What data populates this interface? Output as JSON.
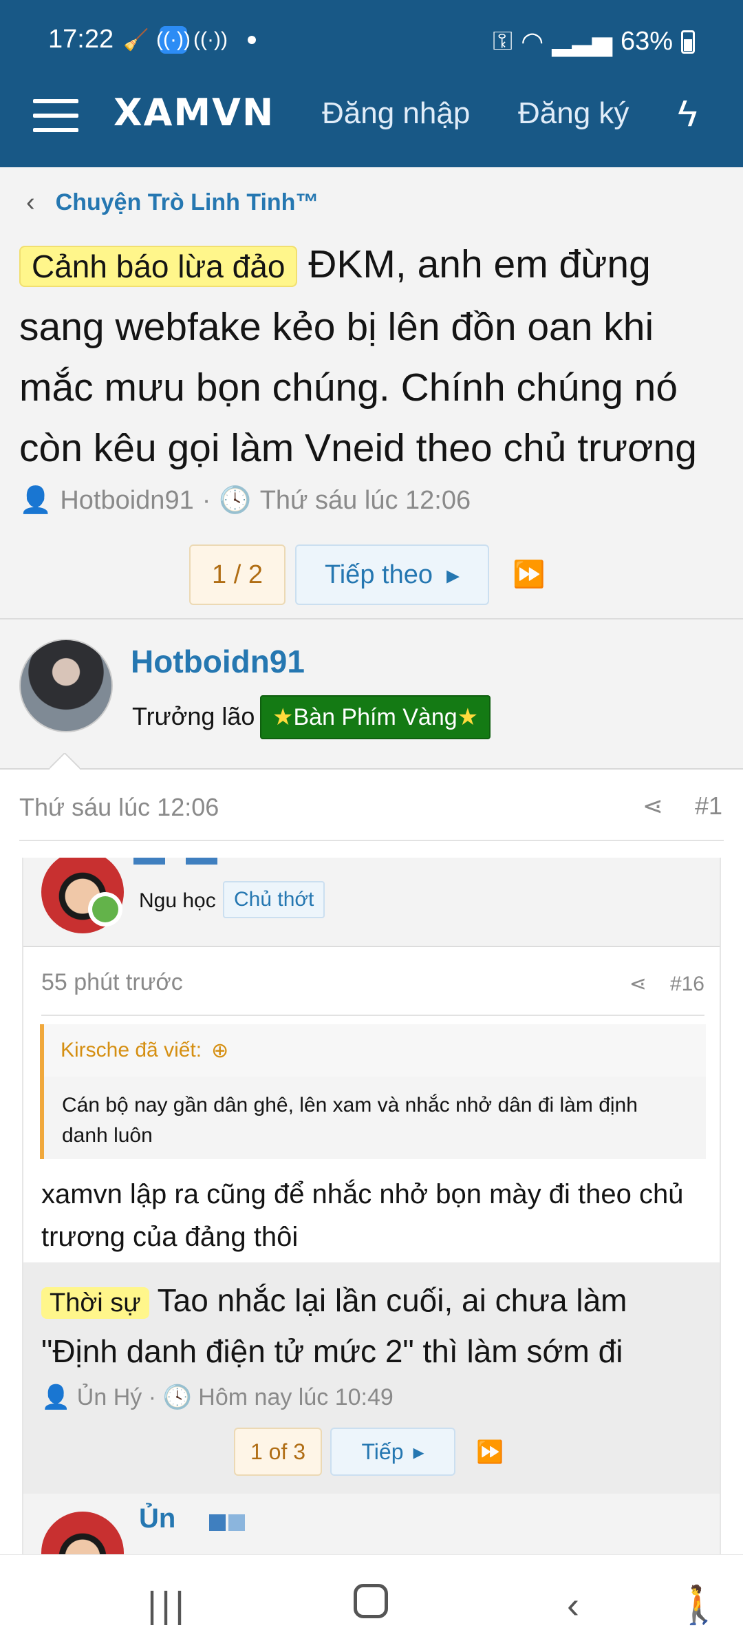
{
  "status": {
    "time": "17:22",
    "battery": "63%"
  },
  "header": {
    "logo": "XAMVN",
    "login": "Đăng nhập",
    "register": "Đăng ký"
  },
  "breadcrumb": "Chuyện Trò Linh Tinh™",
  "thread": {
    "prefix": "Cảnh báo lừa đảo",
    "title": "ĐKM, anh em đừng sang webfake kẻo bị lên đồn oan khi mắc mưu bọn chúng. Chính chúng nó còn kêu gọi làm Vneid theo chủ trương",
    "author": "Hotboidn91",
    "sep": "·",
    "date": "Thứ sáu lúc 12:06",
    "pager": {
      "current": "1 / 2",
      "next": "Tiếp theo"
    }
  },
  "post": {
    "author": "Hotboidn91",
    "user_title": "Trưởng lão",
    "banner": "Bàn Phím Vàng",
    "banner_star": "★",
    "date": "Thứ sáu lúc 12:06",
    "number": "#1"
  },
  "screenshot": {
    "rank": "Ngu học",
    "badge": "Chủ thớt",
    "time": "55 phút trước",
    "number": "#16",
    "quote_author": "Kirsche đã viết:",
    "quote_text": "Cán bộ nay gần dân ghê, lên xam và nhắc nhở dân đi làm định danh luôn",
    "reply": "xamvn lập ra cũng để nhắc nhở bọn mày đi theo chủ trương của đảng thôi",
    "thread_prefix": "Thời sự",
    "thread_title": "Tao nhắc lại lần cuối, ai chưa làm \"Định danh điện tử mức 2\" thì làm sớm đi",
    "thread_author": "Ủn Hý",
    "thread_date": "Hôm nay lúc 10:49",
    "pager_current": "1 of 3",
    "pager_next": "Tiếp",
    "next_author": "Ủn"
  }
}
